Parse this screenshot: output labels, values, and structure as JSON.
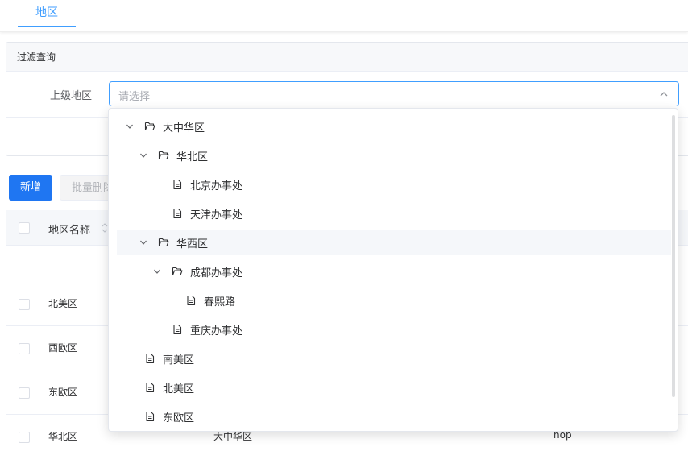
{
  "tabs": [
    {
      "label": "地区",
      "active": true
    }
  ],
  "filter": {
    "title": "过滤查询",
    "parent_label": "上级地区",
    "parent_placeholder": "请选择"
  },
  "toolbar": {
    "new_label": "新增",
    "batch_delete_label": "批量删除"
  },
  "table": {
    "columns": [
      "地区名称"
    ],
    "rows": [
      {
        "name": "北美区",
        "parent": "",
        "code": ""
      },
      {
        "name": "西欧区",
        "parent": "",
        "code": ""
      },
      {
        "name": "东欧区",
        "parent": "",
        "code": ""
      },
      {
        "name": "华北区",
        "parent": "大中华区",
        "code": "nop"
      }
    ]
  },
  "tree": [
    {
      "label": "大中华区",
      "type": "folder",
      "expanded": true,
      "level": 0
    },
    {
      "label": "华北区",
      "type": "folder",
      "expanded": true,
      "level": 1
    },
    {
      "label": "北京办事处",
      "type": "file",
      "level": 2
    },
    {
      "label": "天津办事处",
      "type": "file",
      "level": 2
    },
    {
      "label": "华西区",
      "type": "folder",
      "expanded": true,
      "level": 1,
      "hovered": true
    },
    {
      "label": "成都办事处",
      "type": "folder",
      "expanded": true,
      "level": 2
    },
    {
      "label": "春熙路",
      "type": "file",
      "level": 3
    },
    {
      "label": "重庆办事处",
      "type": "file",
      "level": 2
    },
    {
      "label": "南美区",
      "type": "file",
      "level": 0
    },
    {
      "label": "北美区",
      "type": "file",
      "level": 0
    },
    {
      "label": "东欧区",
      "type": "file",
      "level": 0
    }
  ],
  "colors": {
    "primary": "#1f76f2",
    "accent": "#409eff"
  }
}
